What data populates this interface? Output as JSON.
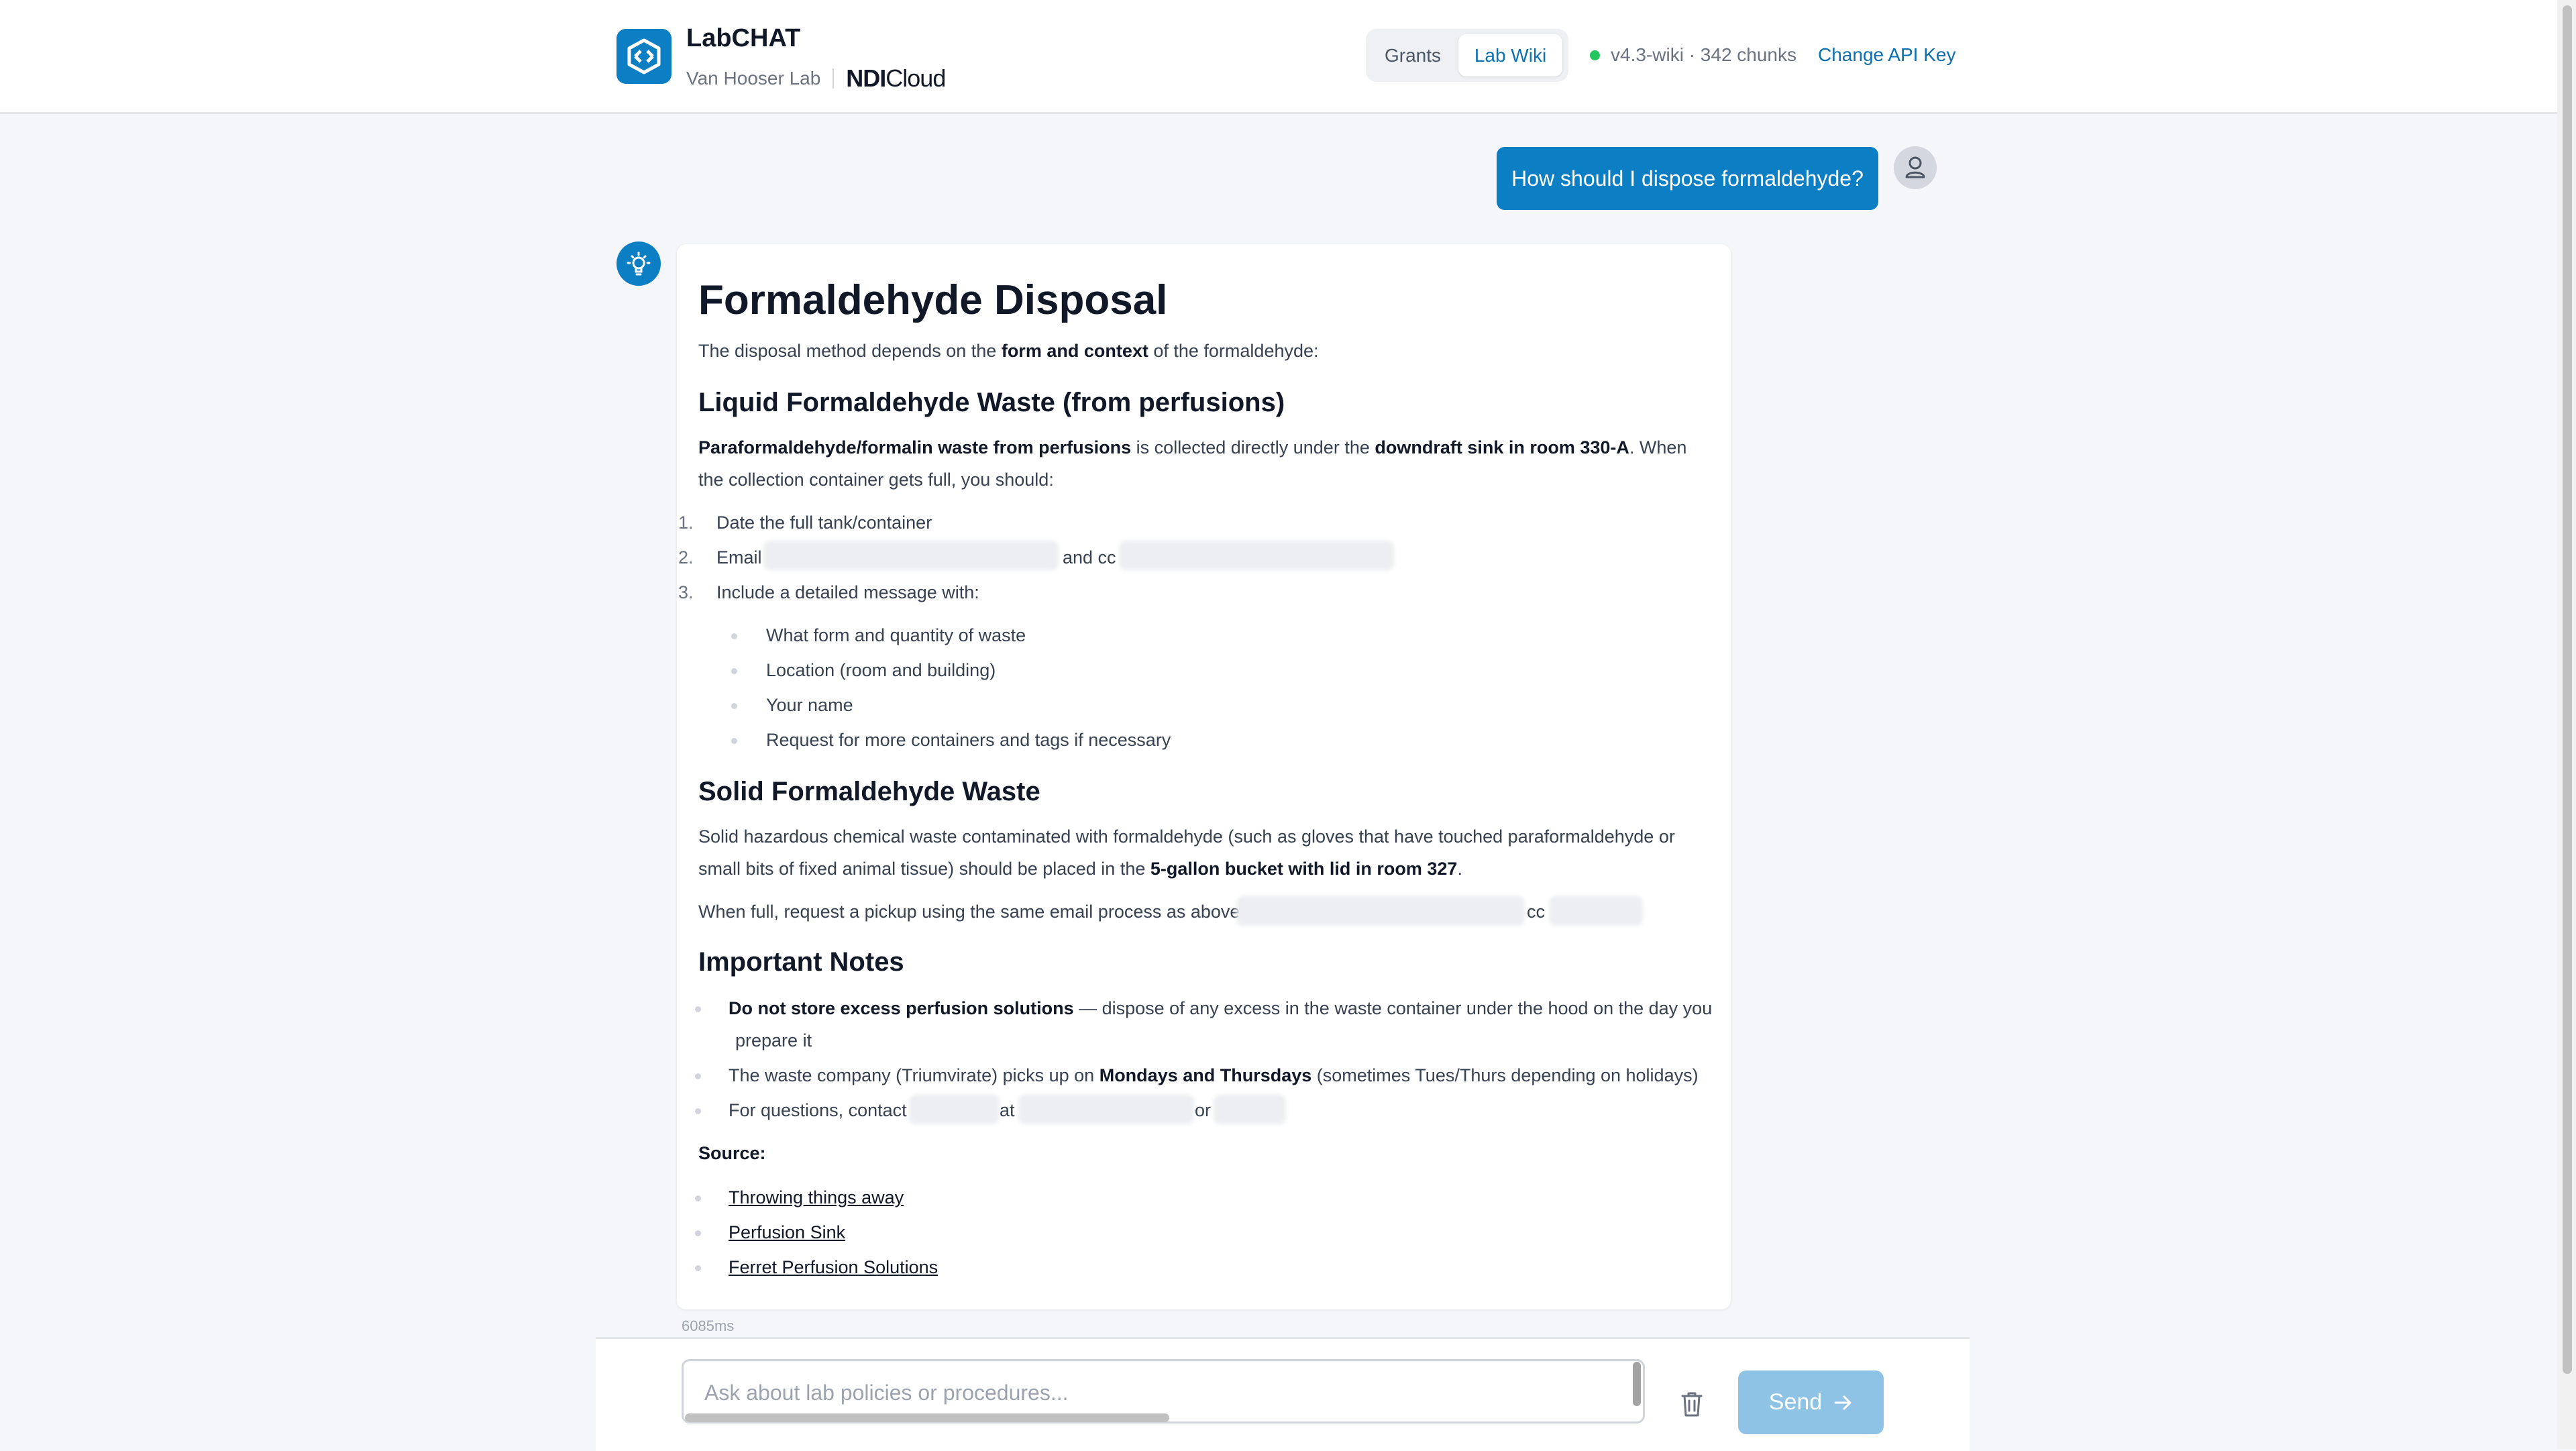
{
  "header": {
    "app_title": "LabCHAT",
    "lab_name": "Van Hooser Lab",
    "partner_logo_bold": "NDI",
    "partner_logo_light": "Cloud",
    "tabs": [
      {
        "label": "Grants",
        "active": false
      },
      {
        "label": "Lab Wiki",
        "active": true
      }
    ],
    "status_text": "v4.3-wiki · 342 chunks",
    "change_api_key": "Change API Key"
  },
  "conversation": {
    "user_message": "How should I dispose formaldehyde?",
    "answer": {
      "title": "Formaldehyde Disposal",
      "intro": {
        "pre": "The disposal method depends on the ",
        "bold": "form and context",
        "post": " of the formaldehyde:"
      },
      "section_liquid": {
        "heading": "Liquid Formaldehyde Waste (from perfusions)",
        "para_bold1": "Paraformaldehyde/formalin waste from perfusions",
        "para_mid": " is collected directly under the ",
        "para_bold2": "downdraft sink in room 330-A",
        "para_post": ". When",
        "para_line2": "the collection container gets full, you should:",
        "steps": [
          {
            "num": "1.",
            "text": "Date the full tank/container"
          },
          {
            "num": "2.",
            "text": "Email",
            "and_cc": "and cc"
          },
          {
            "num": "3.",
            "text": "Include a detailed message with:"
          }
        ],
        "details": [
          "What form and quantity of waste",
          "Location (room and building)",
          "Your name",
          "Request for more containers and tags if necessary"
        ]
      },
      "section_solid": {
        "heading": "Solid Formaldehyde Waste",
        "line1": "Solid hazardous chemical waste contaminated with formaldehyde (such as gloves that have touched paraformaldehyde or",
        "line2_pre": "small bits of fixed animal tissue) should be placed in the ",
        "line2_bold": "5-gallon bucket with lid in room 327",
        "line2_post": ".",
        "pickup": "When full, request a pickup using the same email process as above",
        "cc": "cc"
      },
      "section_notes": {
        "heading": "Important Notes",
        "note1_bold": "Do not store excess perfusion solutions",
        "note1_rest": " — dispose of any excess in the waste container under the hood on the day you",
        "note1_line2": "prepare it",
        "note2_pre": "The waste company (Triumvirate) picks up on ",
        "note2_bold": "Mondays and Thursdays",
        "note2_post": " (sometimes Tues/Thurs depending on holidays)",
        "note3_pre": "For questions, contact",
        "note3_at": "at",
        "note3_or": "or"
      },
      "source_label": "Source:",
      "sources": [
        "Throwing things away",
        "Perfusion Sink",
        "Ferret Perfusion Solutions"
      ]
    },
    "response_time": "6085ms"
  },
  "composer": {
    "placeholder": "Ask about lab policies or procedures...",
    "send_label": "Send"
  },
  "colors": {
    "accent": "#0b7ec4",
    "send_disabled": "#8ec3e6",
    "status_ok": "#22c55e"
  },
  "icons": [
    "app-logo-icon",
    "user-icon",
    "lightbulb-icon",
    "trash-icon",
    "arrow-right-icon"
  ]
}
